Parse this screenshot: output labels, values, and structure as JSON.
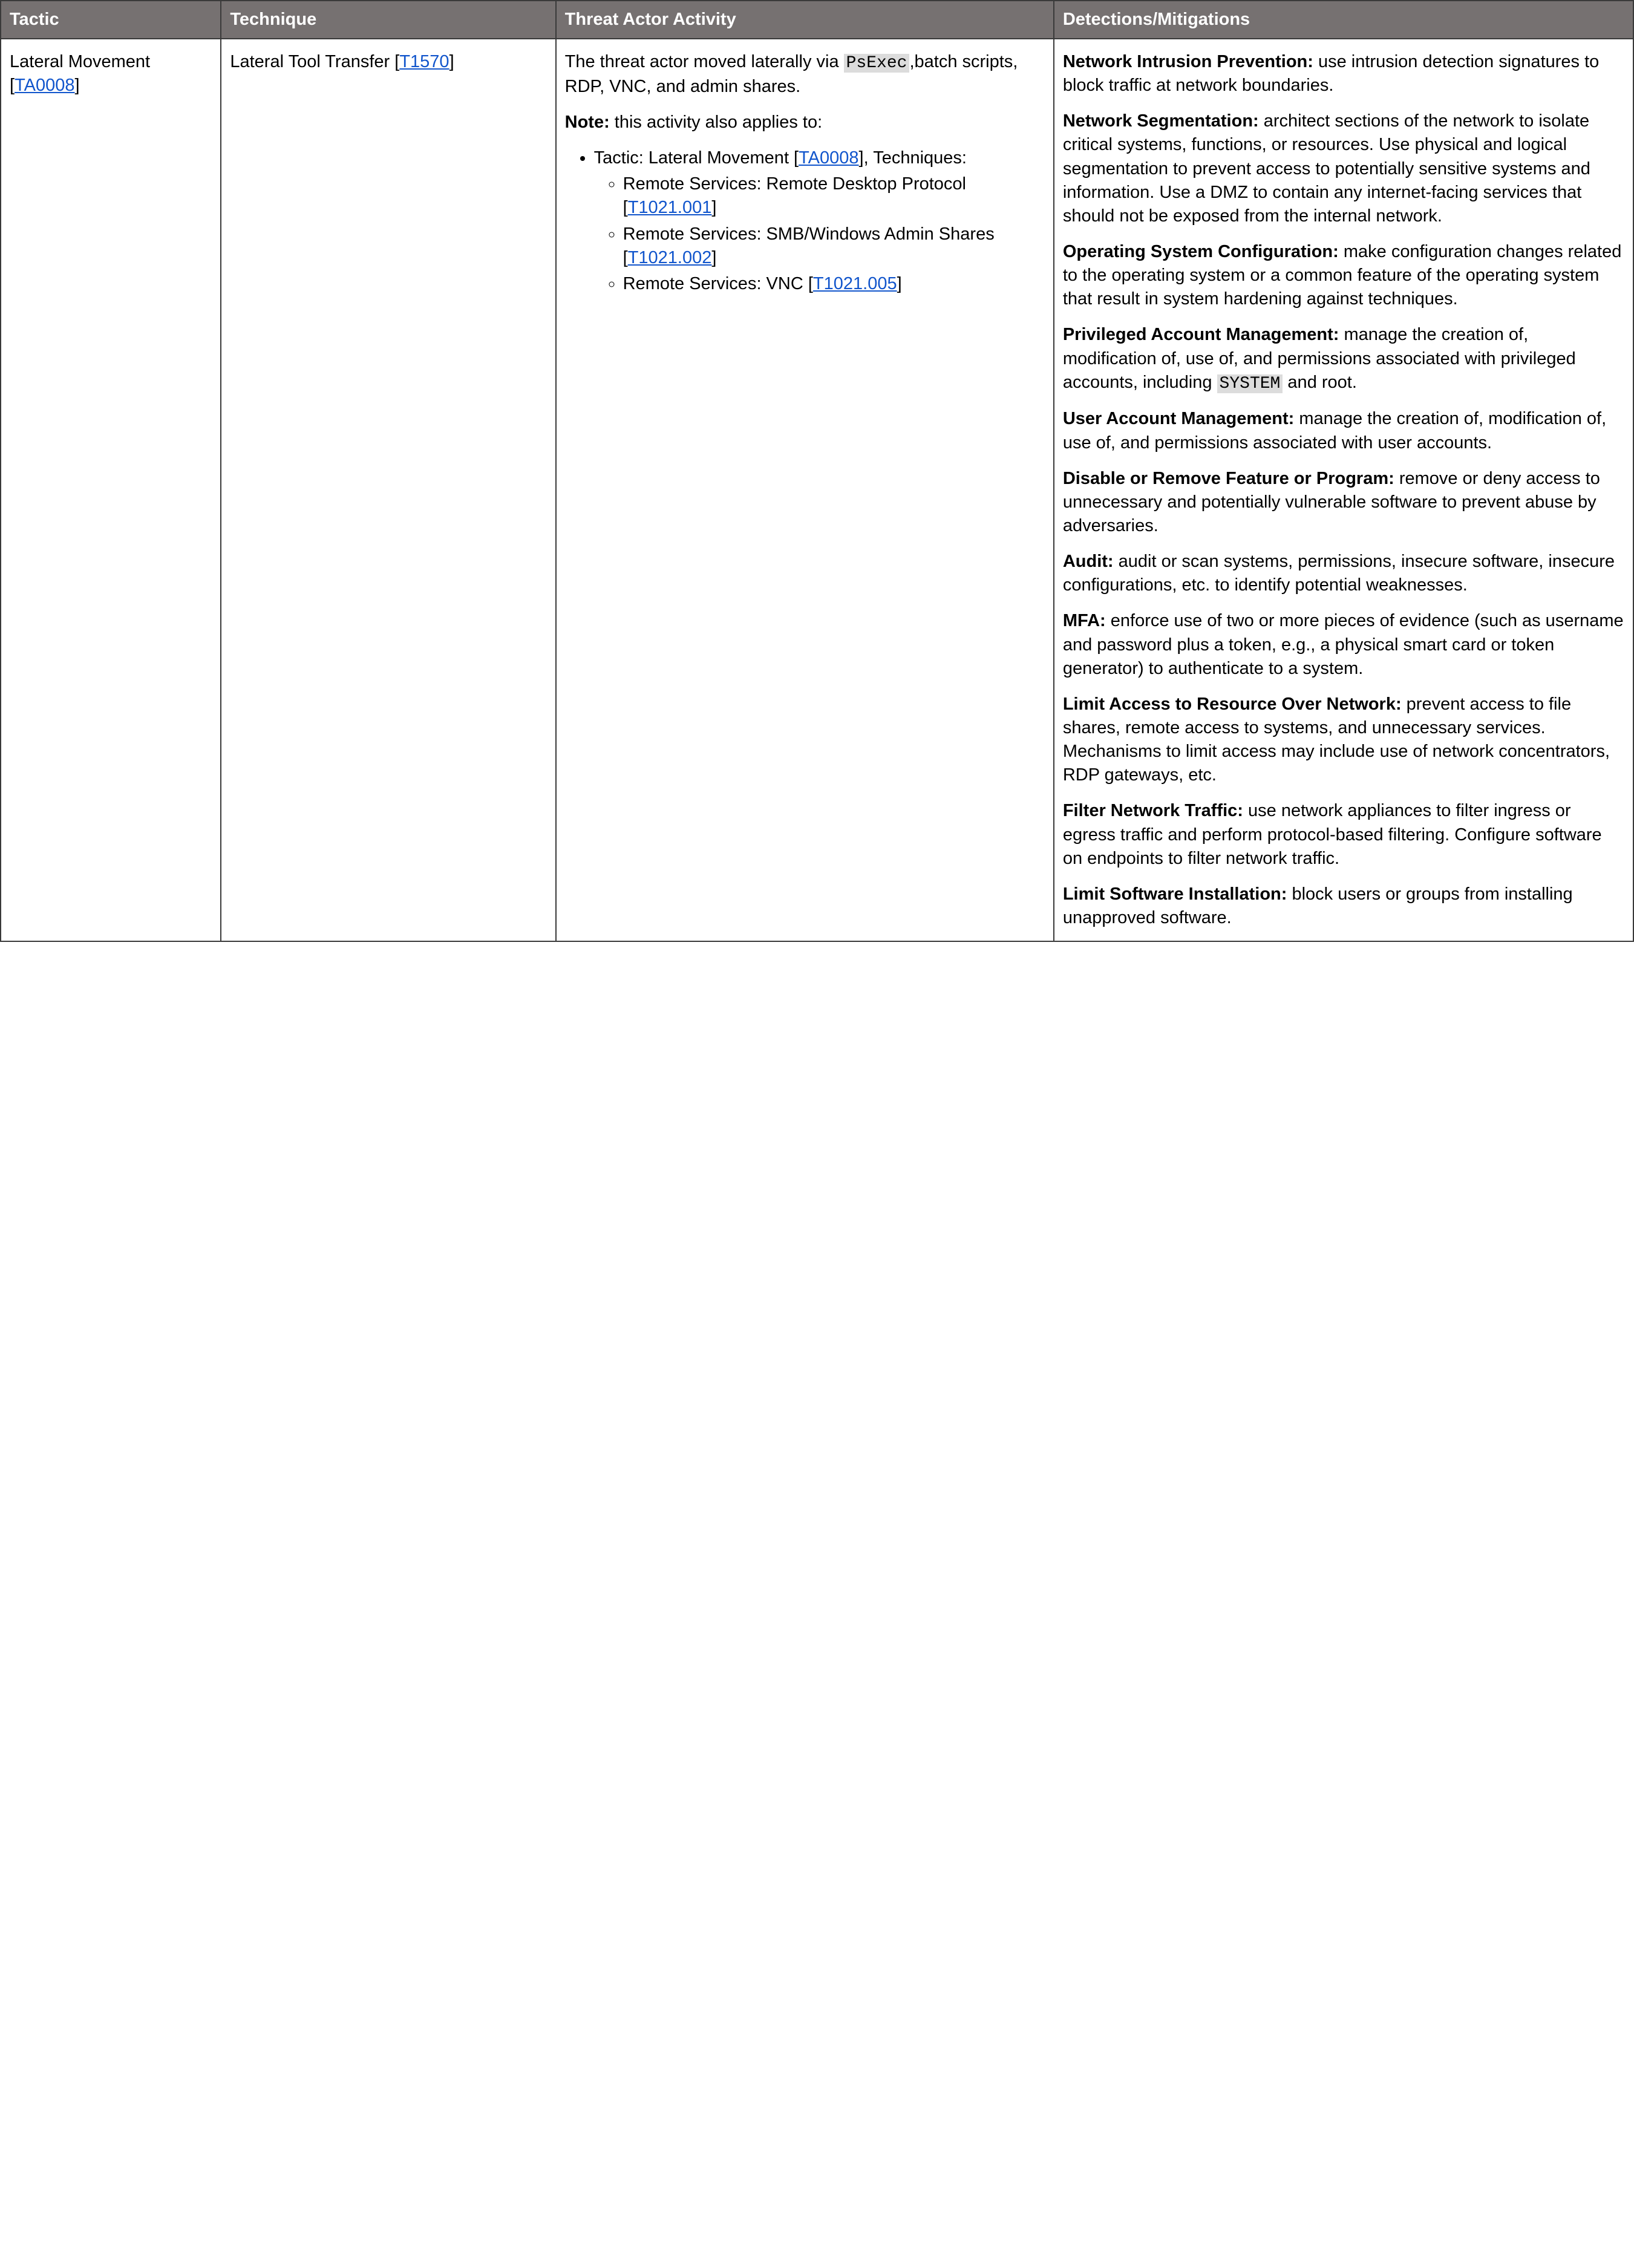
{
  "headers": {
    "tactic": "Tactic",
    "technique": "Technique",
    "activity": "Threat Actor Activity",
    "detections": "Detections/Mitigations"
  },
  "row": {
    "tactic": {
      "name": "Lateral Movement",
      "linkText": "TA0008",
      "prefix": "[",
      "suffix": "]"
    },
    "technique": {
      "name": "Lateral Tool Transfer",
      "linkText": "T1570",
      "prefix": "[",
      "suffix": "]"
    },
    "activity": {
      "intro_before_code": "The threat actor moved laterally via ",
      "code": "PsExec",
      "intro_after_code": ",batch scripts, RDP, VNC, and admin shares.",
      "note_label": "Note:",
      "note_text": " this activity also applies to:",
      "bullet_prefix": "Tactic: Lateral Movement [",
      "bullet_link": "TA0008",
      "bullet_suffix": "], Techniques:",
      "subitems": [
        {
          "before": "Remote Services: Remote Desktop Protocol [",
          "link": "T1021.001",
          "after": "]"
        },
        {
          "before": "Remote Services: SMB/Windows Admin Shares [",
          "link": "T1021.002",
          "after": "]"
        },
        {
          "before": "Remote Services: VNC [",
          "link": "T1021.005",
          "after": "]"
        }
      ]
    },
    "detections": [
      {
        "title": "Network Intrusion Prevention:",
        "body": " use intrusion detection signatures to block traffic at network boundaries."
      },
      {
        "title": "Network Segmentation:",
        "body": " architect sections of the network to isolate critical systems, functions, or resources. Use physical and logical segmentation to prevent access to potentially sensitive systems and information. Use a DMZ to contain any internet-facing services that should not be exposed from the internal network."
      },
      {
        "title": "Operating System Configuration:",
        "body": " make configuration changes related to the operating system or a common feature of the operating system that result in system hardening against techniques."
      },
      {
        "title": "Privileged Account Management:",
        "body_before_code": " manage the creation of, modification of, use of, and permissions associated with privileged accounts, including ",
        "code": "SYSTEM",
        "body_after_code": " and root."
      },
      {
        "title": "User Account Management:",
        "body": " manage the creation of, modification of, use of, and permissions associated with user accounts."
      },
      {
        "title": "Disable or Remove Feature or Program:",
        "body": " remove or deny access to unnecessary and potentially vulnerable software to prevent abuse by adversaries."
      },
      {
        "title": "Audit:",
        "body": " audit or scan systems, permissions, insecure software, insecure configurations, etc. to identify potential weaknesses."
      },
      {
        "title": "MFA:",
        "body": " enforce use of two or more pieces of evidence (such as username and password plus a token, e.g., a physical smart card or token generator) to authenticate to a system."
      },
      {
        "title": "Limit Access to Resource Over Network:",
        "body": " prevent access to file shares, remote access to systems, and unnecessary services. Mechanisms to limit access may include use of network concentrators, RDP gateways, etc."
      },
      {
        "title": "Filter Network Traffic:",
        "body": " use network appliances to filter ingress or egress traffic and perform protocol-based filtering. Configure software on endpoints to filter network traffic."
      },
      {
        "title": "Limit Software Installation:",
        "body": " block users or groups from installing unapproved software."
      }
    ]
  }
}
